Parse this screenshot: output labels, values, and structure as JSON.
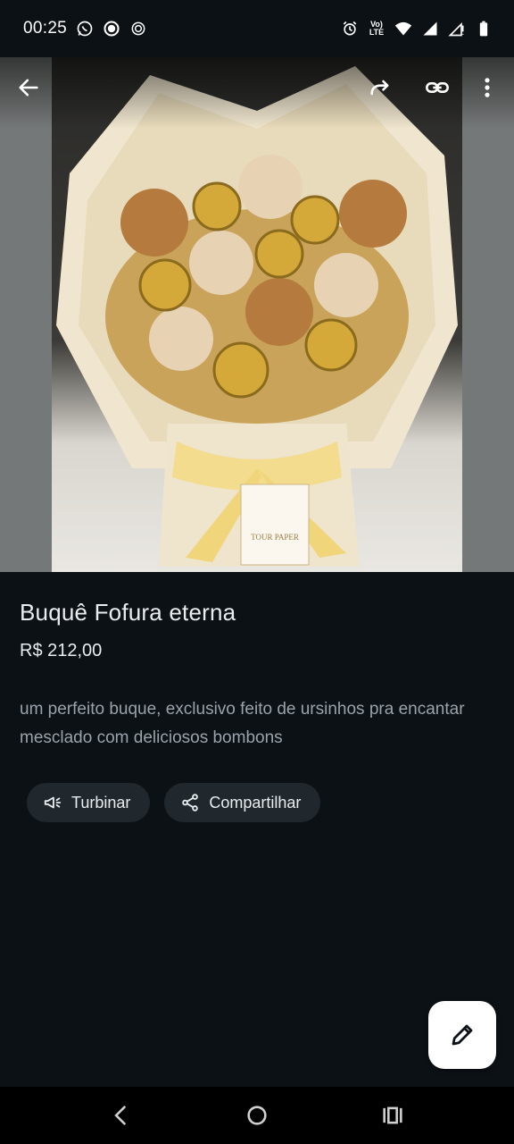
{
  "status_bar": {
    "time": "00:25",
    "lte_top": "Vo)",
    "lte_bottom": "LTE"
  },
  "image_toolbar": {
    "icons": [
      "back-arrow-icon",
      "forward-icon",
      "link-icon",
      "more-vert-icon"
    ]
  },
  "product": {
    "title": "Buquê Fofura eterna",
    "price": "R$ 212,00",
    "description": "um perfeito buque, exclusivo feito de ursinhos pra encantar mesclado com deliciosos bombons",
    "photo_tag_text": "TOUR PAPER"
  },
  "actions": {
    "boost_label": "Turbinar",
    "share_label": "Compartilhar"
  },
  "colors": {
    "background": "#0c1116",
    "chip": "#20272d",
    "accent_gold": "#d4a839"
  }
}
